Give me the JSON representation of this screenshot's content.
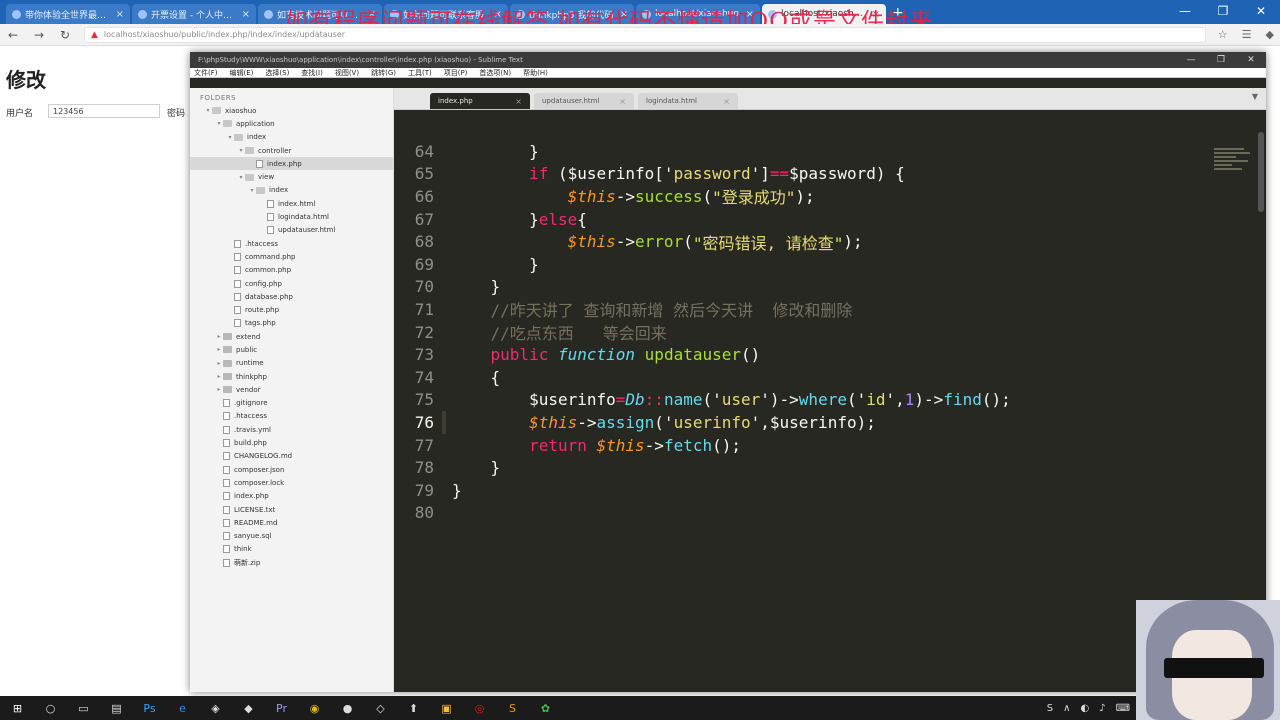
{
  "browser": {
    "tabs": [
      {
        "label": "带你体验全世界最好玩",
        "active": false
      },
      {
        "label": "开票设置 - 个人中心 -",
        "active": false
      },
      {
        "label": "如有技术问题可以在线解",
        "active": false
      },
      {
        "label": "如有问题可联系客服",
        "active": false
      },
      {
        "label": "thinkphp5 我的代码",
        "active": false
      },
      {
        "label": "localhost/xiaoshuo",
        "active": false
      },
      {
        "label": "localhost/xiaoshuo/ind",
        "active": true
      }
    ],
    "new_tab": "+",
    "window_controls": [
      "—",
      "❐",
      "✕"
    ],
    "address": "localhost/xiaoshuo/public/index.php/index/index/updatauser",
    "watermark": "如有程序问题可在线解答  如有代码不懂请加QQ或是文件封来"
  },
  "webpage": {
    "title": "修改",
    "username_label": "用户名",
    "username_value": "123456",
    "password_label": "密码"
  },
  "editor": {
    "title": "F:\\phpStudy\\WWW\\xiaoshuo\\application\\index\\controller\\index.php (xiaoshuo) - Sublime Text",
    "menu": [
      "文件(F)",
      "编辑(E)",
      "选择(S)",
      "查找(I)",
      "视图(V)",
      "跳转(G)",
      "工具(T)",
      "项目(P)",
      "首选项(N)",
      "帮助(H)"
    ],
    "sidebar_header": "FOLDERS",
    "tree": [
      {
        "label": "xiaoshuo",
        "depth": 0,
        "type": "folder-open"
      },
      {
        "label": "application",
        "depth": 1,
        "type": "folder-open"
      },
      {
        "label": "index",
        "depth": 2,
        "type": "folder-open"
      },
      {
        "label": "controller",
        "depth": 3,
        "type": "folder-open"
      },
      {
        "label": "index.php",
        "depth": 4,
        "type": "file",
        "selected": true
      },
      {
        "label": "view",
        "depth": 3,
        "type": "folder-open"
      },
      {
        "label": "index",
        "depth": 4,
        "type": "folder-open"
      },
      {
        "label": "index.html",
        "depth": 5,
        "type": "file"
      },
      {
        "label": "logindata.html",
        "depth": 5,
        "type": "file"
      },
      {
        "label": "updatauser.html",
        "depth": 5,
        "type": "file"
      },
      {
        "label": ".htaccess",
        "depth": 2,
        "type": "file"
      },
      {
        "label": "command.php",
        "depth": 2,
        "type": "file"
      },
      {
        "label": "common.php",
        "depth": 2,
        "type": "file"
      },
      {
        "label": "config.php",
        "depth": 2,
        "type": "file"
      },
      {
        "label": "database.php",
        "depth": 2,
        "type": "file"
      },
      {
        "label": "route.php",
        "depth": 2,
        "type": "file"
      },
      {
        "label": "tags.php",
        "depth": 2,
        "type": "file"
      },
      {
        "label": "extend",
        "depth": 1,
        "type": "folder"
      },
      {
        "label": "public",
        "depth": 1,
        "type": "folder"
      },
      {
        "label": "runtime",
        "depth": 1,
        "type": "folder"
      },
      {
        "label": "thinkphp",
        "depth": 1,
        "type": "folder"
      },
      {
        "label": "vendor",
        "depth": 1,
        "type": "folder"
      },
      {
        "label": ".gitignore",
        "depth": 1,
        "type": "file"
      },
      {
        "label": ".htaccess",
        "depth": 1,
        "type": "file"
      },
      {
        "label": ".travis.yml",
        "depth": 1,
        "type": "file"
      },
      {
        "label": "build.php",
        "depth": 1,
        "type": "file"
      },
      {
        "label": "CHANGELOG.md",
        "depth": 1,
        "type": "file"
      },
      {
        "label": "composer.json",
        "depth": 1,
        "type": "file"
      },
      {
        "label": "composer.lock",
        "depth": 1,
        "type": "file"
      },
      {
        "label": "index.php",
        "depth": 1,
        "type": "file"
      },
      {
        "label": "LICENSE.txt",
        "depth": 1,
        "type": "file"
      },
      {
        "label": "README.md",
        "depth": 1,
        "type": "file"
      },
      {
        "label": "sanyue.sql",
        "depth": 1,
        "type": "file"
      },
      {
        "label": "think",
        "depth": 1,
        "type": "file"
      },
      {
        "label": "萌新.zip",
        "depth": 1,
        "type": "file"
      }
    ],
    "tabs": [
      {
        "label": "index.php",
        "active": true
      },
      {
        "label": "updatauser.html",
        "active": false
      },
      {
        "label": "logindata.html",
        "active": false
      }
    ],
    "code_lines": [
      {
        "n": "64",
        "tokens": [
          [
            "txt",
            "        }"
          ]
        ]
      },
      {
        "n": "65",
        "tokens": [
          [
            "kw",
            "        if"
          ],
          [
            "txt",
            " ($userinfo['"
          ],
          [
            "str",
            "password"
          ],
          [
            "txt",
            "']"
          ],
          [
            "kw",
            "=="
          ],
          [
            "txt",
            "$password) {"
          ]
        ]
      },
      {
        "n": "66",
        "tokens": [
          [
            "this",
            "            $this"
          ],
          [
            "txt",
            "->"
          ],
          [
            "fnn",
            "success"
          ],
          [
            "txt",
            "("
          ],
          [
            "str",
            "\"登录成功\""
          ],
          [
            "txt",
            ");"
          ]
        ]
      },
      {
        "n": "67",
        "tokens": [
          [
            "txt",
            "        }"
          ],
          [
            "kw",
            "else"
          ],
          [
            "txt",
            "{"
          ]
        ]
      },
      {
        "n": "68",
        "tokens": [
          [
            "this",
            "            $this"
          ],
          [
            "txt",
            "->"
          ],
          [
            "fnn",
            "error"
          ],
          [
            "txt",
            "("
          ],
          [
            "str",
            "\"密码错误, 请检查\""
          ],
          [
            "txt",
            ");"
          ]
        ]
      },
      {
        "n": "69",
        "tokens": [
          [
            "txt",
            "        }"
          ]
        ]
      },
      {
        "n": "70",
        "tokens": [
          [
            "txt",
            "    }"
          ]
        ]
      },
      {
        "n": "71",
        "tokens": [
          [
            "cmt",
            "    //昨天讲了 查询和新增 然后今天讲  修改和删除"
          ]
        ]
      },
      {
        "n": "72",
        "tokens": [
          [
            "cmt",
            "    //吃点东西   等会回来"
          ]
        ]
      },
      {
        "n": "73",
        "tokens": [
          [
            "kw",
            "    public"
          ],
          [
            "txt",
            " "
          ],
          [
            "sto",
            "function"
          ],
          [
            "txt",
            " "
          ],
          [
            "fnn",
            "updatauser"
          ],
          [
            "txt",
            "()"
          ]
        ]
      },
      {
        "n": "74",
        "tokens": [
          [
            "txt",
            "    {"
          ]
        ]
      },
      {
        "n": "75",
        "tokens": [
          [
            "txt",
            "        $userinfo"
          ],
          [
            "kw",
            "="
          ],
          [
            "cls",
            "Db"
          ],
          [
            "kw",
            "::"
          ],
          [
            "fn",
            "name"
          ],
          [
            "txt",
            "('"
          ],
          [
            "str",
            "user"
          ],
          [
            "txt",
            "')->"
          ],
          [
            "fn",
            "where"
          ],
          [
            "txt",
            "('"
          ],
          [
            "str",
            "id"
          ],
          [
            "txt",
            "',"
          ],
          [
            "num",
            "1"
          ],
          [
            "txt",
            ")->"
          ],
          [
            "fn",
            "find"
          ],
          [
            "txt",
            "();"
          ]
        ]
      },
      {
        "n": "76",
        "tokens": [
          [
            "this",
            "        $this"
          ],
          [
            "txt",
            "->"
          ],
          [
            "fn",
            "assign"
          ],
          [
            "txt",
            "('"
          ],
          [
            "str",
            "userinfo"
          ],
          [
            "txt",
            "',$userinfo);"
          ]
        ]
      },
      {
        "n": "77",
        "tokens": [
          [
            "kw",
            "        return"
          ],
          [
            "txt",
            " "
          ],
          [
            "this",
            "$this"
          ],
          [
            "txt",
            "->"
          ],
          [
            "fn",
            "fetch"
          ],
          [
            "txt",
            "();"
          ]
        ]
      },
      {
        "n": "78",
        "tokens": [
          [
            "txt",
            "    }"
          ]
        ]
      },
      {
        "n": "79",
        "tokens": [
          [
            "txt",
            "}"
          ]
        ]
      },
      {
        "n": "80",
        "tokens": [
          [
            "txt",
            ""
          ]
        ]
      }
    ],
    "current_line": "76"
  },
  "taskbar": {
    "start_icon": "windows-icon",
    "apps": [
      "search-icon",
      "task-view-icon",
      "file-explorer-icon",
      "photoshop-icon",
      "edge-icon",
      "shield-icon",
      "app-icon",
      "premiere-icon",
      "chrome-icon",
      "browser-icon",
      "cube-icon",
      "sublime-icon",
      "folder-icon",
      "netease-music-icon",
      "sublime-text-icon",
      "wechat-icon"
    ]
  },
  "colors": {
    "editor_bg": "#272822",
    "keyword": "#f92672",
    "string": "#e6db74",
    "function": "#a6e22e",
    "comment": "#75715e",
    "watermark": "#e8214a",
    "browser_tabstrip": "#1f64b4"
  }
}
